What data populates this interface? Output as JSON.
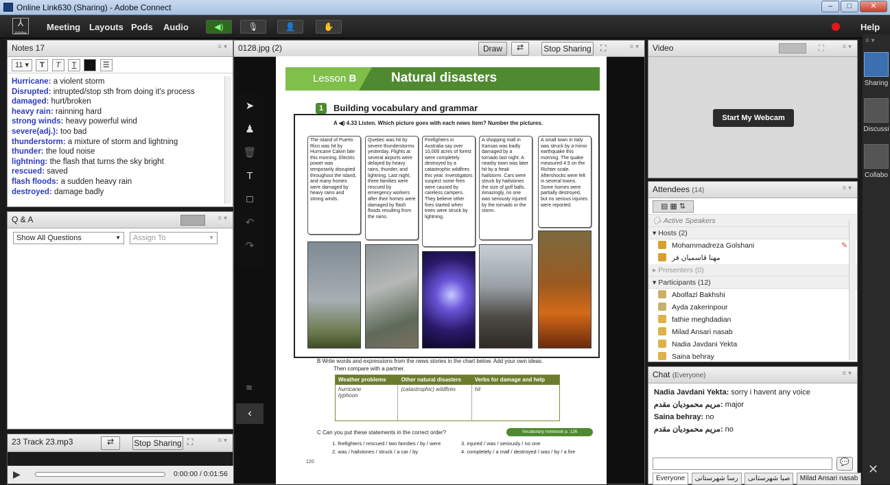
{
  "window": {
    "title": "Online Link630 (Sharing) - Adobe Connect",
    "min": "–",
    "max": "□",
    "close": "✕"
  },
  "menu": {
    "logo": "Adobe",
    "items": [
      "Meeting",
      "Layouts",
      "Pods",
      "Audio"
    ],
    "speaker": "◀)",
    "mic": "🎙",
    "cam": "👤",
    "hand": "✋",
    "help": "Help"
  },
  "notes": {
    "title": "Notes 17",
    "font_size": "11",
    "bold": "T",
    "italic": "T",
    "underline": "T",
    "list": "☰",
    "lines": [
      {
        "term": "Hurricane:",
        "def": " a violent storm"
      },
      {
        "term": "Disrupted:",
        "def": " intrupted/stop sth from doing it's process"
      },
      {
        "term": "damaged:",
        "def": " hurt/broken"
      },
      {
        "term": "heavy rain:",
        "def": " rainning hard"
      },
      {
        "term": "strong winds:",
        "def": " heavy powerful wind"
      },
      {
        "term": "severe(adj.):",
        "def": " too bad"
      },
      {
        "term": "thunderstorm:",
        "def": " a mixture of storm and lightning"
      },
      {
        "term": "thunder:",
        "def": " the loud noise"
      },
      {
        "term": "lightning:",
        "def": " the flash that turns the sky bright"
      },
      {
        "term": "rescued:",
        "def": " saved"
      },
      {
        "term": "flash floods:",
        "def": " a sudden heavy rain"
      },
      {
        "term": "destroyed:",
        "def": " damage badly"
      }
    ]
  },
  "qa": {
    "title": "Q & A",
    "filter": "Show All Questions",
    "assign": "Assign To"
  },
  "track": {
    "title": "23 Track 23.mp3",
    "stop": "Stop Sharing",
    "time": "0:00:00 / 0:01:56",
    "progress": 0
  },
  "share": {
    "title": "0128.jpg (2)",
    "draw": "Draw",
    "stop": "Stop Sharing"
  },
  "doc": {
    "lesson": "Lesson",
    "lesson_letter": "B",
    "heading": "Natural disasters",
    "section1_num": "1",
    "section1": "Building vocabulary and grammar",
    "instr_a": "A  ◀) 4.33  Listen. Which picture goes with each news item? Number the pictures.",
    "stories": [
      "The island of Puerto Rico was hit by Hurricane Calvin late this morning. Electric power was temporarily disrupted throughout the island, and many homes were damaged by heavy rains and strong winds.",
      "Quebec was hit by severe thunderstorms yesterday. Flights at several airports were delayed by heavy rains, thunder, and lightning. Last night, three families were rescued by emergency workers after their homes were damaged by flash floods resulting from the rains.",
      "Firefighters in Australia say over 10,000 acres of forest were completely destroyed by a catastrophic wildfires this year. Investigators suspect some fires were caused by careless campers. They believe other fires started when trees were struck by lightning.",
      "A shopping mall in Kansas was badly damaged by a tornado last night. A nearby town was later hit by a freak hailstorm. Cars were struck by hailstones the size of golf balls. Amazingly, no one was seriously injured by the tornado or the storm.",
      "A small town in Italy was struck by a minor earthquake this morning. The quake measured 4.9 on the Richter scale. Aftershocks were felt in several towns. Some homes were partially destroyed, but no serious injuries were reported."
    ],
    "instr_b": "B  Write words and expressions from the news stories in the chart below. Add your own ideas.",
    "instr_b2": "Then compare with a partner.",
    "chart_head": [
      "Weather problems",
      "Other natural disasters",
      "Verbs for damage and help"
    ],
    "chart_cells": [
      "hurricane\ntyphoon",
      "(catastrophic) wildfires",
      "hit"
    ],
    "instr_c": "C  Can you put these statements in the correct order?",
    "vocab_note": "Vocabulary notebook p. 126",
    "c_items": [
      "1.  firefighters / rescued / two families / by / were",
      "2.  was / hailstones / struck / a car / by",
      "3.  injured / was / seriously / no one",
      "4.  completely / a mall / destroyed / was / by / a fire"
    ],
    "page": "120"
  },
  "video": {
    "title": "Video",
    "start": "Start My Webcam"
  },
  "attendees": {
    "title": "Attendees",
    "count": "(14)",
    "active": "Active Speakers",
    "hosts_label": "Hosts (2)",
    "hosts": [
      "Mohammadreza Golshani",
      "مهنا قاسمیان فر"
    ],
    "presenters_label": "Presenters (0)",
    "participants_label": "Participants (12)",
    "participants": [
      "Abolfazl Bakhshi",
      "Ayda zakerinpour",
      "fathie meghdadian",
      "Milad Ansari nasab",
      "Nadia Javdani Yekta",
      "Saina behray"
    ]
  },
  "chat": {
    "title": "Chat",
    "scope": "(Everyone)",
    "messages": [
      {
        "who": "Nadia Javdani Yekta:",
        "text": " sorry i havent  any voice"
      },
      {
        "who": "مریم محمودیان مقدم:",
        "text": " major"
      },
      {
        "who": "Saina behray:",
        "text": " no"
      },
      {
        "who": "مریم محمودیان مقدم:",
        "text": " no"
      }
    ],
    "tabs": [
      "Everyone",
      "رسا شهرستانی",
      "صبا شهرستانی",
      "Milad Ansari nasab"
    ]
  },
  "layouts": [
    {
      "label": "Sharing"
    },
    {
      "label": "Discussi"
    },
    {
      "label": "Collabo"
    }
  ]
}
